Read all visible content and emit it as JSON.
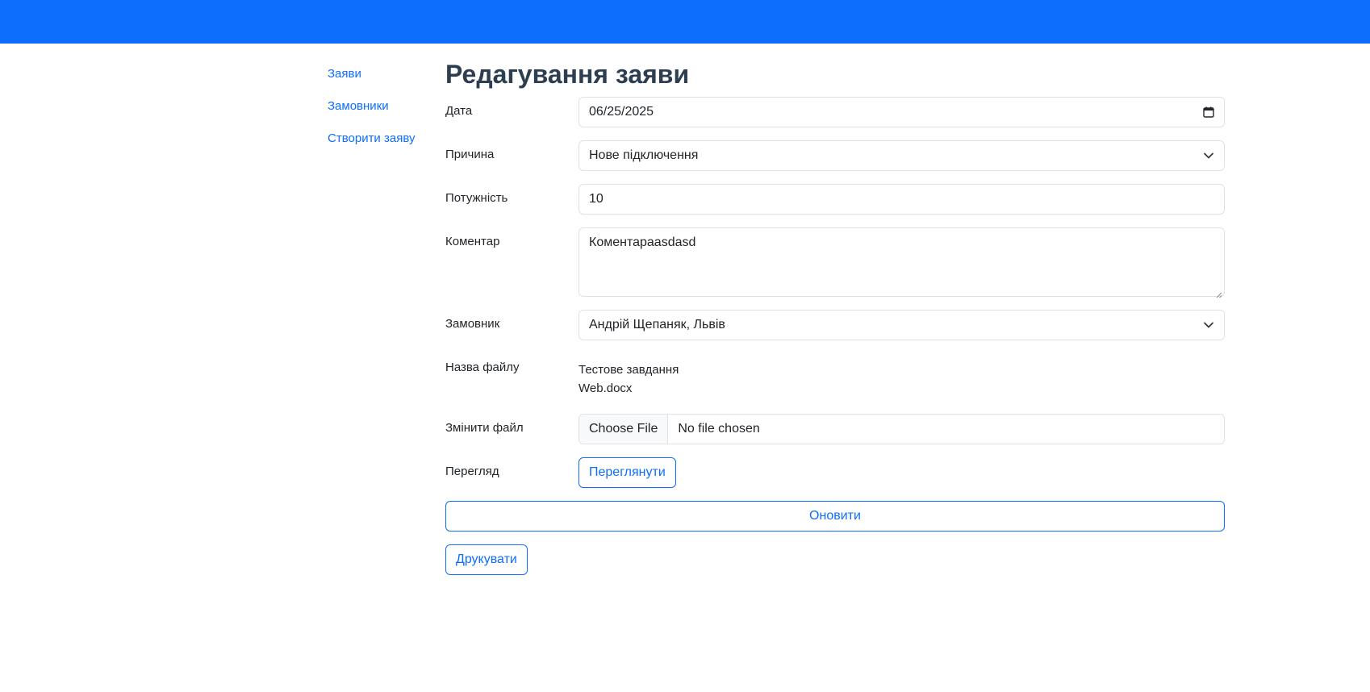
{
  "colors": {
    "topbar": "#0d6efd",
    "link": "#0d6efd",
    "title": "#2c3e50",
    "border": "#dee2e6"
  },
  "sidebar": {
    "items": [
      {
        "label": "Заяви"
      },
      {
        "label": "Замовники"
      },
      {
        "label": "Створити заяву"
      }
    ]
  },
  "page": {
    "title": "Редагування заяви"
  },
  "form": {
    "date": {
      "label": "Дата",
      "value": "06/25/2025",
      "icon": "calendar-icon"
    },
    "reason": {
      "label": "Причина",
      "value": "Нове підключення",
      "icon": "chevron-down-icon"
    },
    "power": {
      "label": "Потужність",
      "value": "10"
    },
    "comment": {
      "label": "Коментар",
      "value": "Коментараasdasd"
    },
    "customer": {
      "label": "Замовник",
      "value": "Андрій Щепаняк, Львів",
      "icon": "chevron-down-icon"
    },
    "file_name": {
      "label": "Назва файлу",
      "line1": "Тестове завдання",
      "line2": "Web.docx"
    },
    "change_file": {
      "label": "Змінити файл",
      "button": "Choose File",
      "status": "No file chosen"
    },
    "preview": {
      "label": "Перегляд",
      "button": "Переглянути"
    },
    "update_button": "Оновити",
    "print_button": "Друкувати"
  }
}
